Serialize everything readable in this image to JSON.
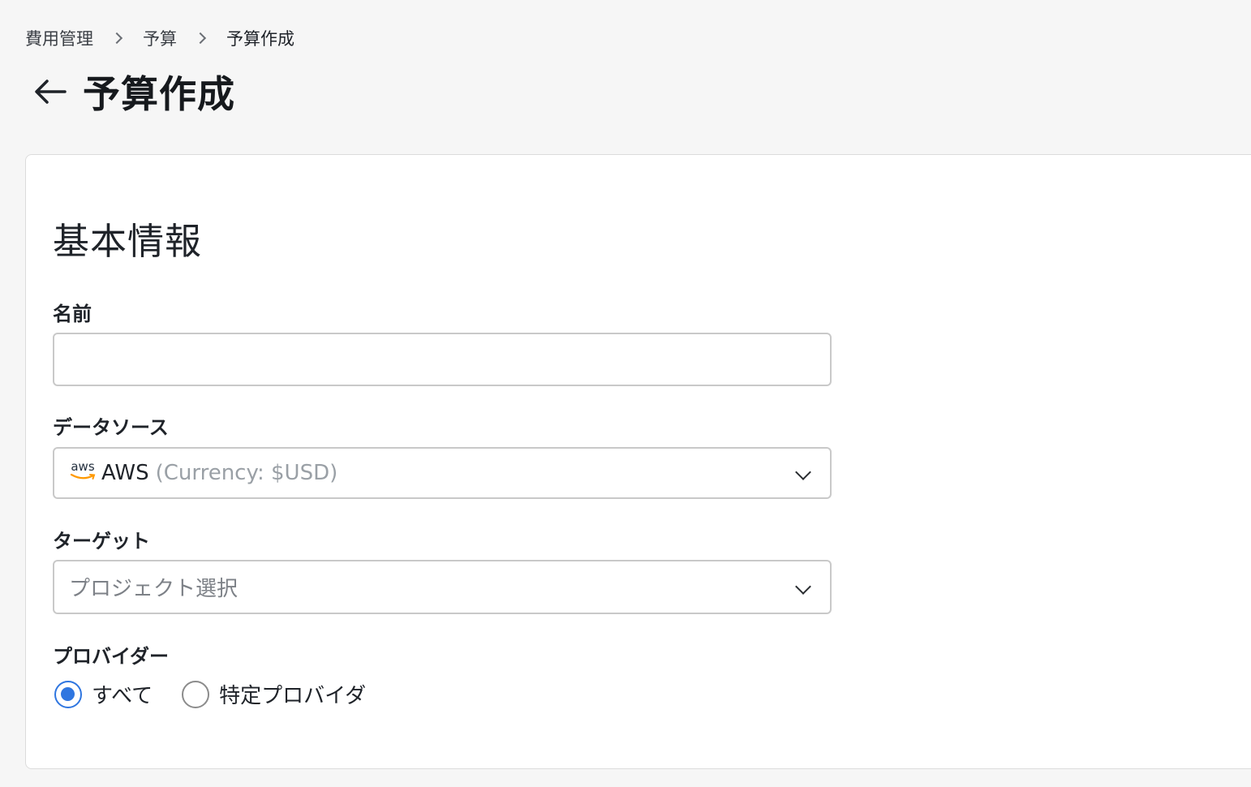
{
  "breadcrumb": {
    "items": [
      "費用管理",
      "予算",
      "予算作成"
    ]
  },
  "header": {
    "title": "予算作成"
  },
  "form": {
    "section_title": "基本情報",
    "name": {
      "label": "名前",
      "value": "",
      "placeholder": ""
    },
    "data_source": {
      "label": "データソース",
      "logo_text": "aws",
      "selected_main": "AWS",
      "selected_sub": "(Currency: $USD)"
    },
    "target": {
      "label": "ターゲット",
      "placeholder": "プロジェクト選択"
    },
    "provider": {
      "label": "プロバイダー",
      "options": [
        {
          "label": "すべて",
          "checked": true
        },
        {
          "label": "特定プロバイダ",
          "checked": false
        }
      ]
    }
  },
  "colors": {
    "accent": "#2f76e0",
    "aws_orange": "#ff9900",
    "background": "#f6f6f6"
  }
}
